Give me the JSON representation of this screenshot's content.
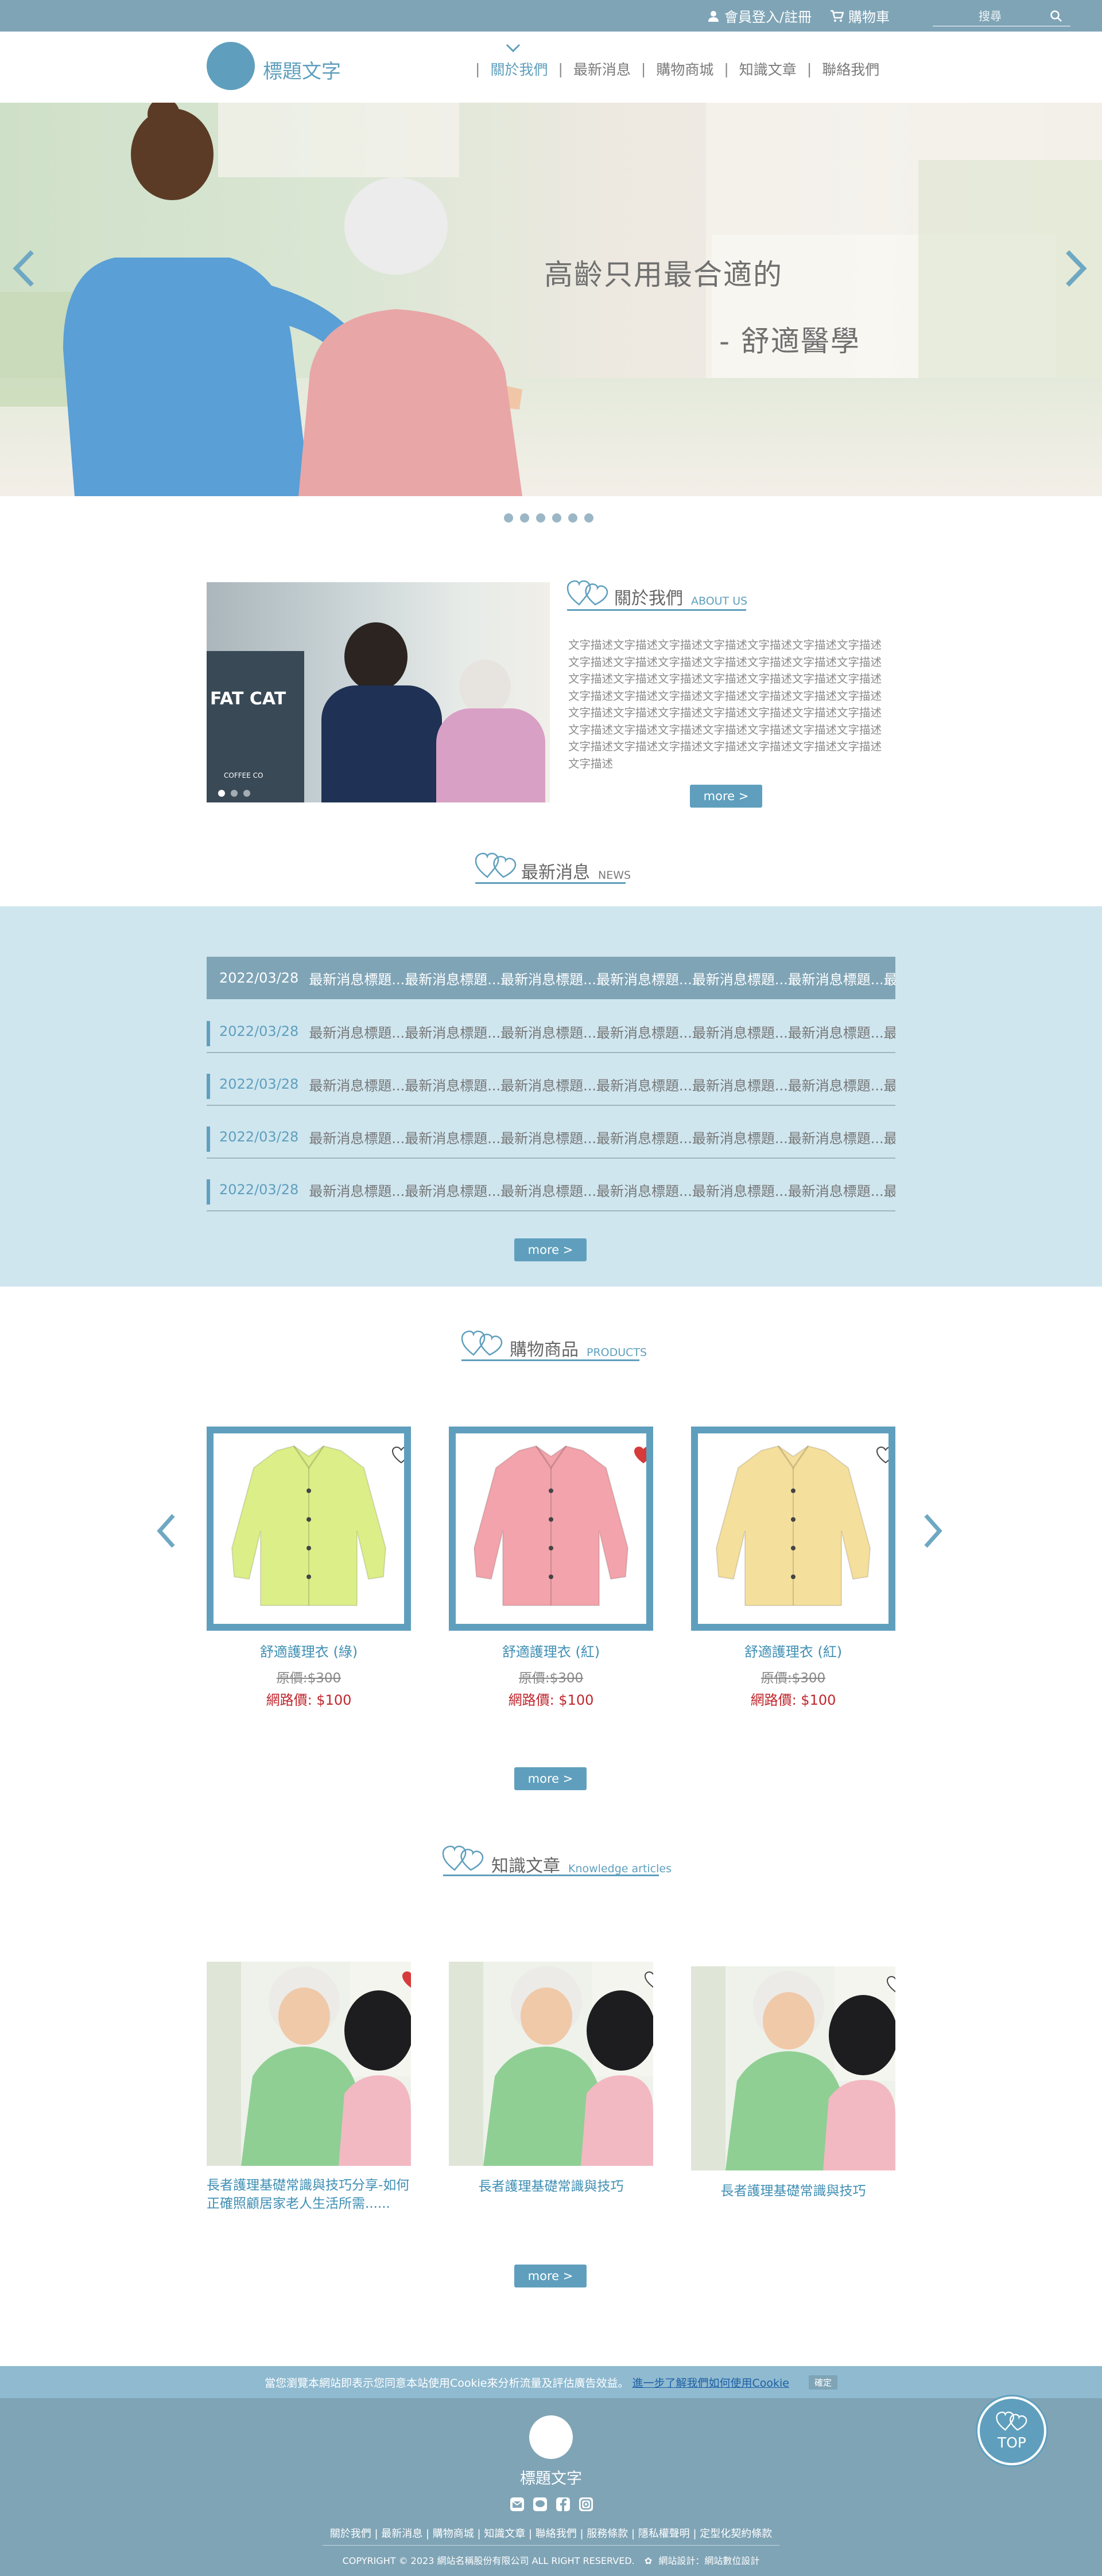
{
  "topbar": {
    "login_label": "會員登入/註冊",
    "cart_label": "購物車",
    "search_placeholder": "搜尋"
  },
  "header": {
    "logo_text": "標題文字",
    "nav": [
      "關於我們",
      "最新消息",
      "購物商城",
      "知識文章",
      "聯絡我們"
    ],
    "active_index": 0
  },
  "hero": {
    "line1": "高齡只用最合適的",
    "line2": "- 舒適醫學",
    "slide_count": 6
  },
  "about": {
    "title_zh": "關於我們",
    "title_en": "ABOUT US",
    "body": "文字描述文字描述文字描述文字描述文字描述文字描述文字描述文字描述文字描述文字描述文字描述文字描述文字描述文字描述文字描述文字描述文字描述文字描述文字描述文字描述文字描述文字描述文字描述文字描述文字描述文字描述文字描述文字描述文字描述文字描述文字描述文字描述文字描述文字描述文字描述文字描述文字描述文字描述文字描述文字描述文字描述文字描述文字描述文字描述文字描述文字描述文字描述文字描述文字描述文字描述",
    "more": "more >",
    "image_text": "FAT CAT",
    "image_sub": "COFFEE CO"
  },
  "news": {
    "title_zh": "最新消息",
    "title_en": "NEWS",
    "items": [
      {
        "date": "2022/03/28",
        "text": "最新消息標題...最新消息標題...最新消息標題...最新消息標題...最新消息標題...最新消息標題...最新"
      },
      {
        "date": "2022/03/28",
        "text": "最新消息標題...最新消息標題...最新消息標題...最新消息標題...最新消息標題...最新消息標題...最新"
      },
      {
        "date": "2022/03/28",
        "text": "最新消息標題...最新消息標題...最新消息標題...最新消息標題...最新消息標題...最新消息標題...最新"
      },
      {
        "date": "2022/03/28",
        "text": "最新消息標題...最新消息標題...最新消息標題...最新消息標題...最新消息標題...最新消息標題...最新"
      },
      {
        "date": "2022/03/28",
        "text": "最新消息標題...最新消息標題...最新消息標題...最新消息標題...最新消息標題...最新消息標題...最新"
      }
    ],
    "more": "more >"
  },
  "products": {
    "title_zh": "購物商品",
    "title_en": "PRODUCTS",
    "items": [
      {
        "name": "舒適護理衣 (綠)",
        "old_price": "原價:$300",
        "price": "網路價: $100",
        "color": "#dcee88",
        "favorited": false
      },
      {
        "name": "舒適護理衣 (紅)",
        "old_price": "原價:$300",
        "price": "網路價: $100",
        "color": "#f2a3ab",
        "favorited": true
      },
      {
        "name": "舒適護理衣 (紅)",
        "old_price": "原價:$300",
        "price": "網路價: $100",
        "color": "#f4df9c",
        "favorited": false
      }
    ],
    "more": "more >"
  },
  "articles": {
    "title_zh": "知識文章",
    "title_en": "Knowledge articles",
    "items": [
      {
        "title": "長者護理基礎常識與技巧分享-如何正確照顧居家老人生活所需......",
        "favorited": true
      },
      {
        "title": "長者護理基礎常識與技巧",
        "favorited": false
      },
      {
        "title": "長者護理基礎常識與技巧",
        "favorited": false
      }
    ],
    "more": "more >"
  },
  "cookie": {
    "text": "當您瀏覽本網站即表示您同意本站使用Cookie來分析流量及評估廣告效益。",
    "link": "進一步了解我們如何使用Cookie",
    "button": "確定"
  },
  "footer": {
    "logo_text": "標題文字",
    "links": "關於我們 | 最新消息 | 購物商城 | 知識文章 | 聯絡我們 | 服務條款 | 隱私權聲明 | 定型化契約條款",
    "copyright": "COPYRIGHT © 2023 網站名稱股份有限公司 ALL RIGHT RESERVED.",
    "design": "網站設計：網站數位設計",
    "top": "TOP"
  },
  "colors": {
    "accent": "#5f9fbd",
    "topbar": "#7fa4b6",
    "news_bg": "#cfe6ef",
    "price_red": "#c0262d"
  }
}
